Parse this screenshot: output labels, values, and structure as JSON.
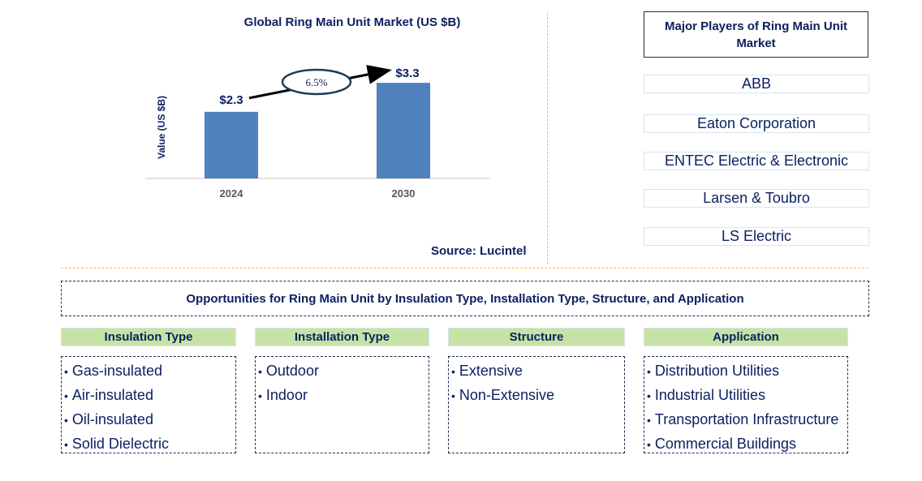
{
  "chart_data": {
    "type": "bar",
    "title": "Global Ring Main Unit Market (US $B)",
    "xlabel": "",
    "ylabel": "Value (US $B)",
    "categories": [
      "2024",
      "2030"
    ],
    "values": [
      2.3,
      3.3
    ],
    "data_labels": [
      "$2.3",
      "$3.3"
    ],
    "ylim": [
      0,
      3.5
    ],
    "grid": false,
    "bar_color": "#4f81bd",
    "annotation": {
      "type": "cagr-arrow",
      "text": "6.5%",
      "from": "2024",
      "to": "2030"
    }
  },
  "source": "Source: Lucintel",
  "players": {
    "title": "Major Players of Ring Main Unit Market",
    "items": [
      "ABB",
      "Eaton Corporation",
      "ENTEC Electric & Electronic",
      "Larsen & Toubro",
      "LS Electric"
    ]
  },
  "opportunities": {
    "title": "Opportunities for Ring Main Unit by Insulation Type, Installation Type, Structure, and Application",
    "segments": [
      {
        "heading": "Insulation Type",
        "items": [
          "Gas-insulated",
          "Air-insulated",
          "Oil-insulated",
          "Solid Dielectric"
        ]
      },
      {
        "heading": "Installation Type",
        "items": [
          "Outdoor",
          "Indoor"
        ]
      },
      {
        "heading": "Structure",
        "items": [
          "Extensive",
          "Non-Extensive"
        ]
      },
      {
        "heading": "Application",
        "items": [
          "Distribution Utilities",
          "Industrial Utilities",
          "Transportation Infrastructure",
          "Commercial Buildings"
        ]
      }
    ]
  },
  "colors": {
    "text": "#0d2161",
    "divider": "#f5c242",
    "segment_header": "#c6e2a4",
    "bar": "#4f81bd"
  }
}
